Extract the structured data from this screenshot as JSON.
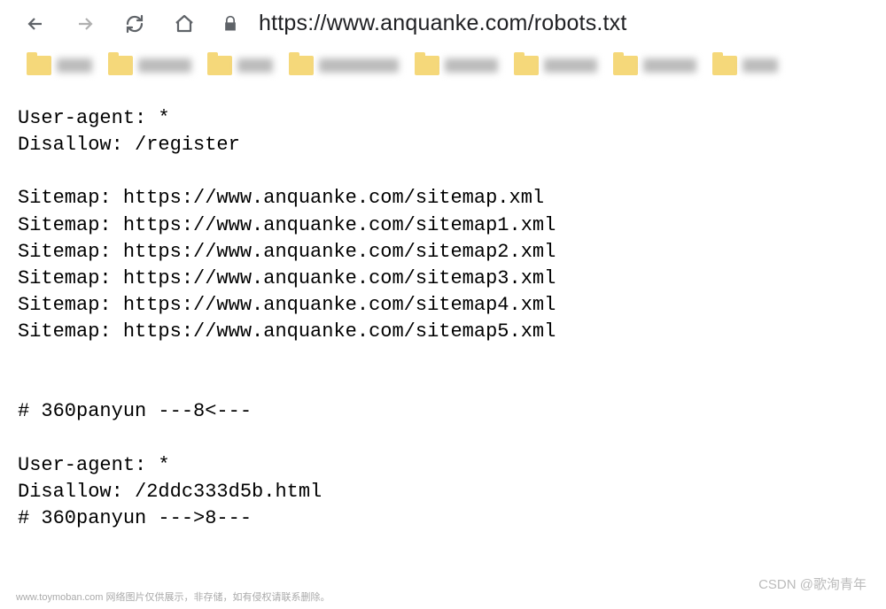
{
  "toolbar": {
    "url": "https://www.anquanke.com/robots.txt"
  },
  "content": {
    "lines": [
      "User-agent: *",
      "Disallow: /register",
      "",
      "Sitemap: https://www.anquanke.com/sitemap.xml",
      "Sitemap: https://www.anquanke.com/sitemap1.xml",
      "Sitemap: https://www.anquanke.com/sitemap2.xml",
      "Sitemap: https://www.anquanke.com/sitemap3.xml",
      "Sitemap: https://www.anquanke.com/sitemap4.xml",
      "Sitemap: https://www.anquanke.com/sitemap5.xml",
      "",
      "",
      "# 360panyun ---8<---",
      "",
      "User-agent: *",
      "Disallow: /2ddc333d5b.html",
      "# 360panyun --->8---"
    ]
  },
  "watermarks": {
    "left": "www.toymoban.com 网络图片仅供展示，非存储，如有侵权请联系删除。",
    "right": "CSDN @歌洵青年"
  }
}
